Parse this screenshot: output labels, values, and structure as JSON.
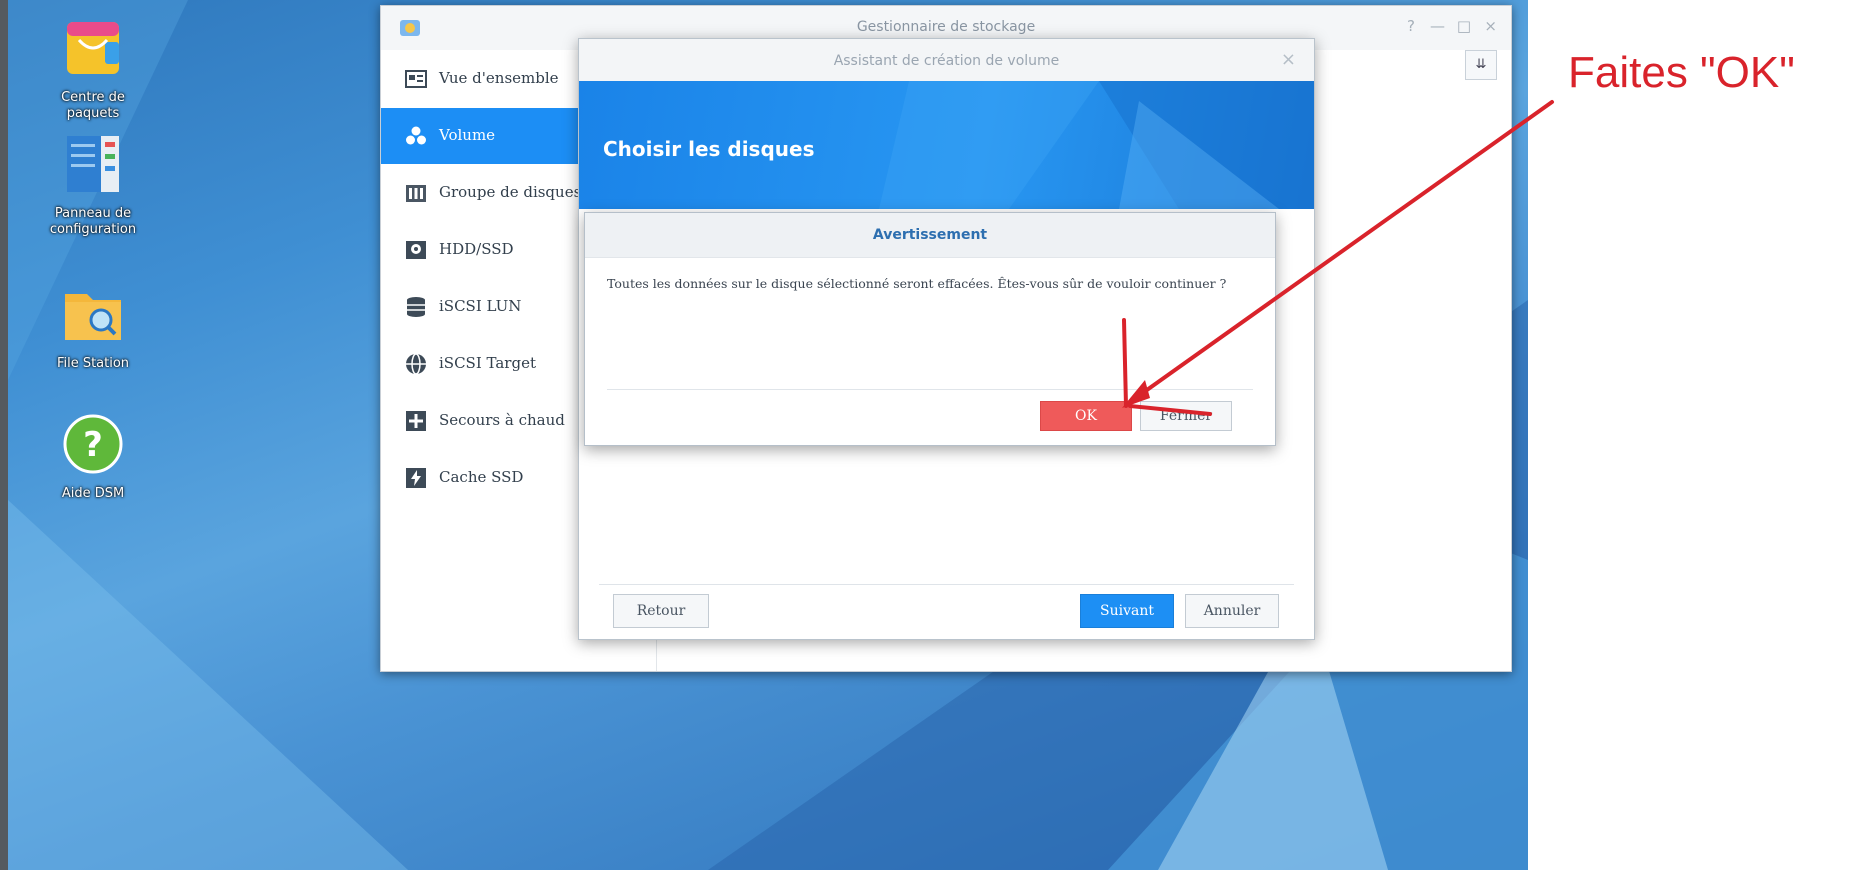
{
  "desktop": {
    "icons": [
      {
        "label": "Centre de paquets",
        "icon": "package-center-icon"
      },
      {
        "label": "Panneau de configuration",
        "icon": "control-panel-icon"
      },
      {
        "label": "File Station",
        "icon": "file-station-icon"
      },
      {
        "label": "Aide DSM",
        "icon": "help-icon"
      }
    ]
  },
  "storage_window": {
    "title": "Gestionnaire de stockage",
    "controls": {
      "help": "?",
      "minimize": "—",
      "maximize": "□",
      "close": "×"
    },
    "sort_icon": "⇊",
    "sidebar": [
      {
        "label": "Vue d'ensemble",
        "icon": "overview-icon"
      },
      {
        "label": "Volume",
        "icon": "volume-icon",
        "active": true
      },
      {
        "label": "Groupe de disques",
        "icon": "disk-group-icon"
      },
      {
        "label": "HDD/SSD",
        "icon": "hdd-icon"
      },
      {
        "label": "iSCSI LUN",
        "icon": "iscsi-lun-icon"
      },
      {
        "label": "iSCSI Target",
        "icon": "iscsi-target-icon"
      },
      {
        "label": "Secours à chaud",
        "icon": "hot-spare-icon"
      },
      {
        "label": "Cache SSD",
        "icon": "ssd-cache-icon"
      }
    ]
  },
  "wizard": {
    "title": "Assistant de création de volume",
    "close": "×",
    "heading": "Choisir les disques",
    "buttons": {
      "back": "Retour",
      "next": "Suivant",
      "cancel": "Annuler"
    }
  },
  "warning": {
    "title": "Avertissement",
    "message": "Toutes les données sur le disque sélectionné seront effacées. Êtes-vous sûr de vouloir continuer ?",
    "buttons": {
      "ok": "OK",
      "close": "Fermer"
    }
  },
  "annotation": {
    "text": "Faites \"OK\"",
    "color": "#d9232b"
  }
}
